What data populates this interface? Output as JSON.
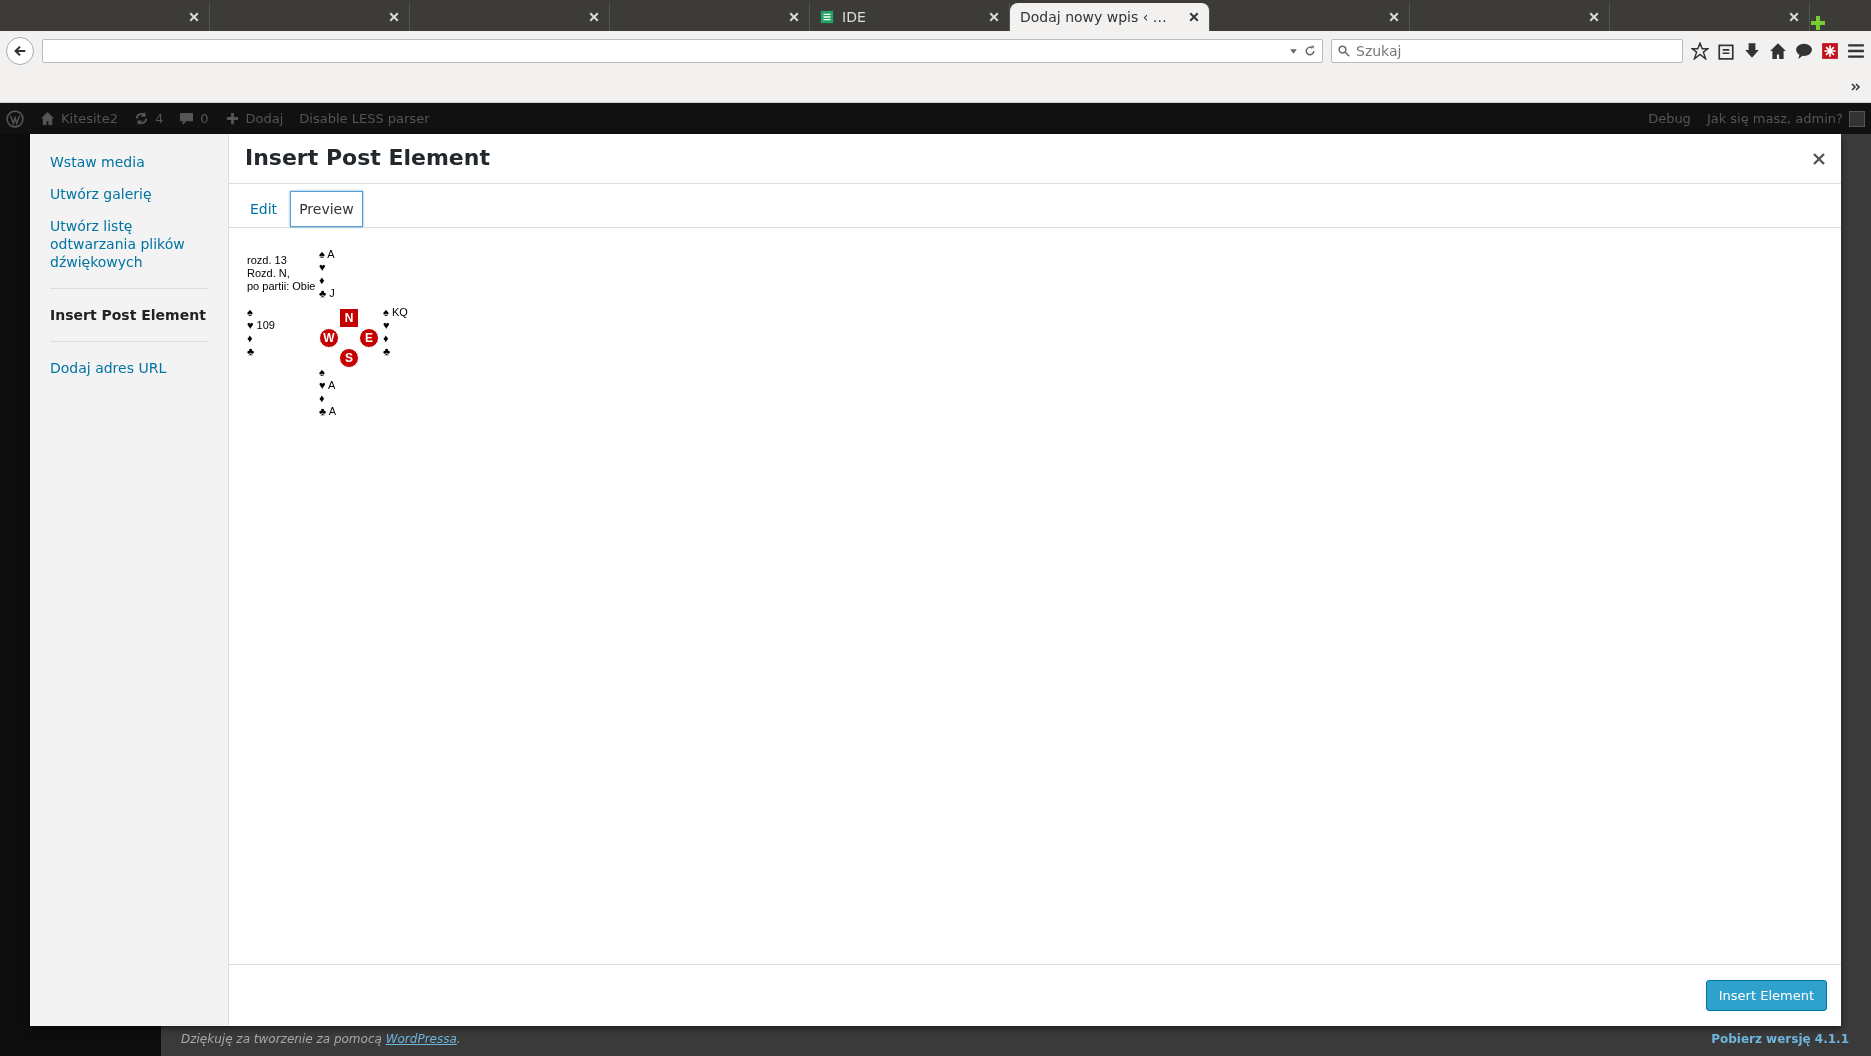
{
  "browser": {
    "tabs": [
      {
        "selected": false
      },
      {
        "selected": false
      },
      {
        "selected": false
      },
      {
        "selected": false
      },
      {
        "label": "IDE",
        "selected": false
      },
      {
        "label": "Dodaj nowy wpis ‹ …",
        "selected": true
      },
      {
        "selected": false
      },
      {
        "selected": false
      },
      {
        "selected": false
      }
    ],
    "search": {
      "placeholder": "Szukaj"
    }
  },
  "admin_bar": {
    "items": [
      {
        "kind": "logo"
      },
      {
        "kind": "home",
        "label": "Kitesite2"
      },
      {
        "kind": "updates",
        "label": "4"
      },
      {
        "kind": "comments",
        "label": "0"
      },
      {
        "kind": "new",
        "label": "Dodaj"
      },
      {
        "kind": "text",
        "label": "Disable LESS parser"
      }
    ],
    "right": [
      {
        "kind": "text",
        "label": "Debug"
      },
      {
        "kind": "account",
        "label": "Jak się masz, admin?"
      }
    ]
  },
  "modal": {
    "title": "Insert Post Element",
    "sidebar": {
      "groups": [
        {
          "items": [
            {
              "label": "Wstaw media",
              "selected": false
            },
            {
              "label": "Utwórz galerię",
              "selected": false
            },
            {
              "label": "Utwórz listę odtwarzania plików dźwiękowych",
              "selected": false
            }
          ]
        },
        {
          "items": [
            {
              "label": "Insert Post Element",
              "selected": true
            }
          ]
        },
        {
          "items": [
            {
              "label": "Dodaj adres URL",
              "selected": false
            }
          ]
        }
      ]
    },
    "tabs": [
      {
        "label": "Edit",
        "selected": false
      },
      {
        "label": "Preview",
        "selected": true
      }
    ],
    "deal": {
      "info": [
        "rozd. 13",
        "Rozd. N,",
        "po partii: Obie"
      ],
      "compass": {
        "north": "N",
        "west": "W",
        "east": "E",
        "south": "S"
      },
      "hands": {
        "north": [
          {
            "suit": "♠",
            "cards": "A"
          },
          {
            "suit": "♥"
          },
          {
            "suit": "♦"
          },
          {
            "suit": "♣",
            "cards": "J"
          }
        ],
        "west": [
          {
            "suit": "♠"
          },
          {
            "suit": "♥",
            "cards": "109"
          },
          {
            "suit": "♦"
          },
          {
            "suit": "♣"
          }
        ],
        "east": [
          {
            "suit": "♠",
            "cards": "KQ"
          },
          {
            "suit": "♥"
          },
          {
            "suit": "♦"
          },
          {
            "suit": "♣"
          }
        ],
        "south": [
          {
            "suit": "♠"
          },
          {
            "suit": "♥",
            "cards": "A"
          },
          {
            "suit": "♦"
          },
          {
            "suit": "♣",
            "cards": "A"
          }
        ]
      }
    },
    "button": "Insert Element"
  },
  "page_footer": {
    "credit_before": "Dziękuję za tworzenie za pomocą ",
    "credit_link": "WordPressa",
    "credit_after": ".",
    "version": "Pobierz wersję 4.1.1"
  }
}
